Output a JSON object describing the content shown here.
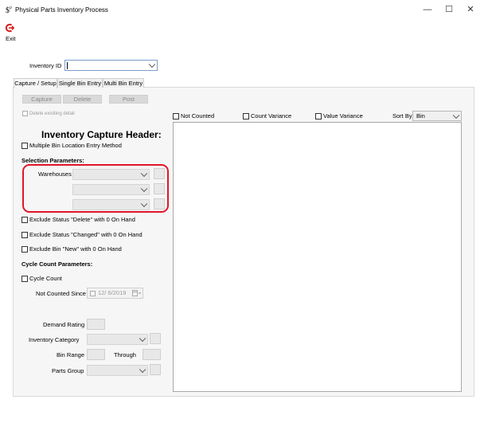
{
  "window": {
    "title": "Physical Parts Inventory Process",
    "minimize": "—",
    "maximize": "☐",
    "close": "✕"
  },
  "toolbar": {
    "exit_label": "Exit"
  },
  "inventory_id": {
    "label": "Inventory ID",
    "value": ""
  },
  "tabs": [
    {
      "label": "Capture / Setup",
      "active": true
    },
    {
      "label": "Single Bin Entry",
      "active": false
    },
    {
      "label": "Multi Bin Entry",
      "active": false
    }
  ],
  "actions": {
    "capture": "Capture",
    "delete": "Delete",
    "post": "Post"
  },
  "delete_existing": "Delete exisiting detail",
  "header": "Inventory Capture Header:",
  "multi_bin_method": "Multiple Bin Location Entry Method",
  "selection_parameters": "Selection Parameters:",
  "warehouses_label": "Warehouses",
  "exclude": {
    "status_delete": "Exclude Status \"Delete\" with 0 On Hand",
    "status_changed": "Exclude Status \"Changed\" with 0 On Hand",
    "bin_new": "Exclude Bin \"New\" with 0 On Hand"
  },
  "cycle_count_parameters": "Cycle Count Parameters:",
  "cycle_count": "Cycle Count",
  "not_counted_since": {
    "label": "Not Counted Since",
    "value": "12/ 6/2019"
  },
  "demand_rating": "Demand Rating",
  "inventory_category": "Inventory Category",
  "bin_range": "Bin Range",
  "through": "Through",
  "parts_group": "Parts Group",
  "filters": {
    "not_counted": "Not Counted",
    "count_variance": "Count Variance",
    "value_variance": "Value Variance",
    "sort_by_label": "Sort By",
    "sort_by_value": "Bin"
  },
  "colors": {
    "highlight": "#e0162b",
    "exit_icon": "#d81b1b",
    "focus_border": "#7a9cc7"
  }
}
